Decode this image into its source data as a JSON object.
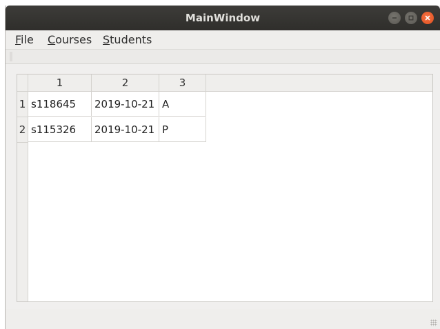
{
  "window": {
    "title": "MainWindow",
    "buttons": [
      {
        "name": "minimize-icon",
        "color": "#6a6863"
      },
      {
        "name": "maximize-icon",
        "color": "#6a6863"
      },
      {
        "name": "close-icon",
        "color": "#e95420"
      }
    ]
  },
  "menubar": {
    "items": [
      {
        "mnemonic": "F",
        "rest": "ile"
      },
      {
        "mnemonic": "C",
        "rest": "ourses"
      },
      {
        "mnemonic": "S",
        "rest": "tudents"
      }
    ]
  },
  "table": {
    "column_headers": [
      "1",
      "2",
      "3"
    ],
    "row_headers": [
      "1",
      "2"
    ],
    "rows": [
      [
        "s118645",
        "2019-10-21",
        "A"
      ],
      [
        "s115326",
        "2019-10-21",
        "P"
      ]
    ]
  }
}
